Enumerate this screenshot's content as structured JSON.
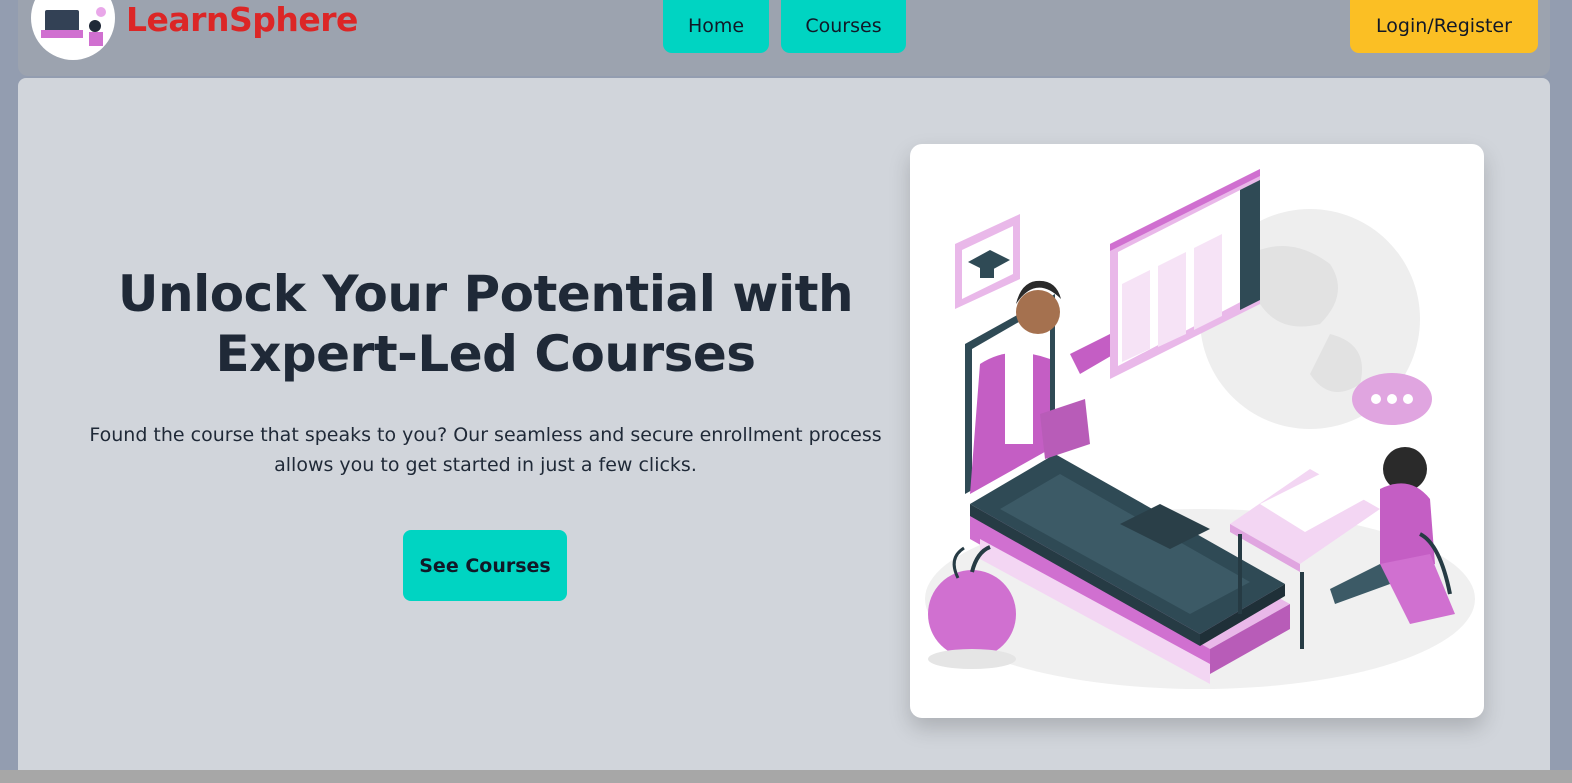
{
  "header": {
    "brand": "LearnSphere",
    "nav": [
      {
        "label": "Home"
      },
      {
        "label": "Courses"
      }
    ],
    "login_label": "Login/Register"
  },
  "hero": {
    "title_line1": "Unlock Your Potential with",
    "title_line2": "Expert-Led Courses",
    "description_line1": "Found the course that speaks to you? Our seamless and secure enrollment process",
    "description_line2": "allows you to get started in just a few clicks.",
    "cta_label": "See Courses"
  },
  "colors": {
    "brand": "#dc2626",
    "nav_button": "#00d4c2",
    "login_button": "#fbbf24",
    "hero_bg": "#d1d5db",
    "illustration_accent": "#d070d0"
  },
  "icons": [
    "logo-icon",
    "graduation-cap-icon",
    "chat-bubble-icon"
  ]
}
